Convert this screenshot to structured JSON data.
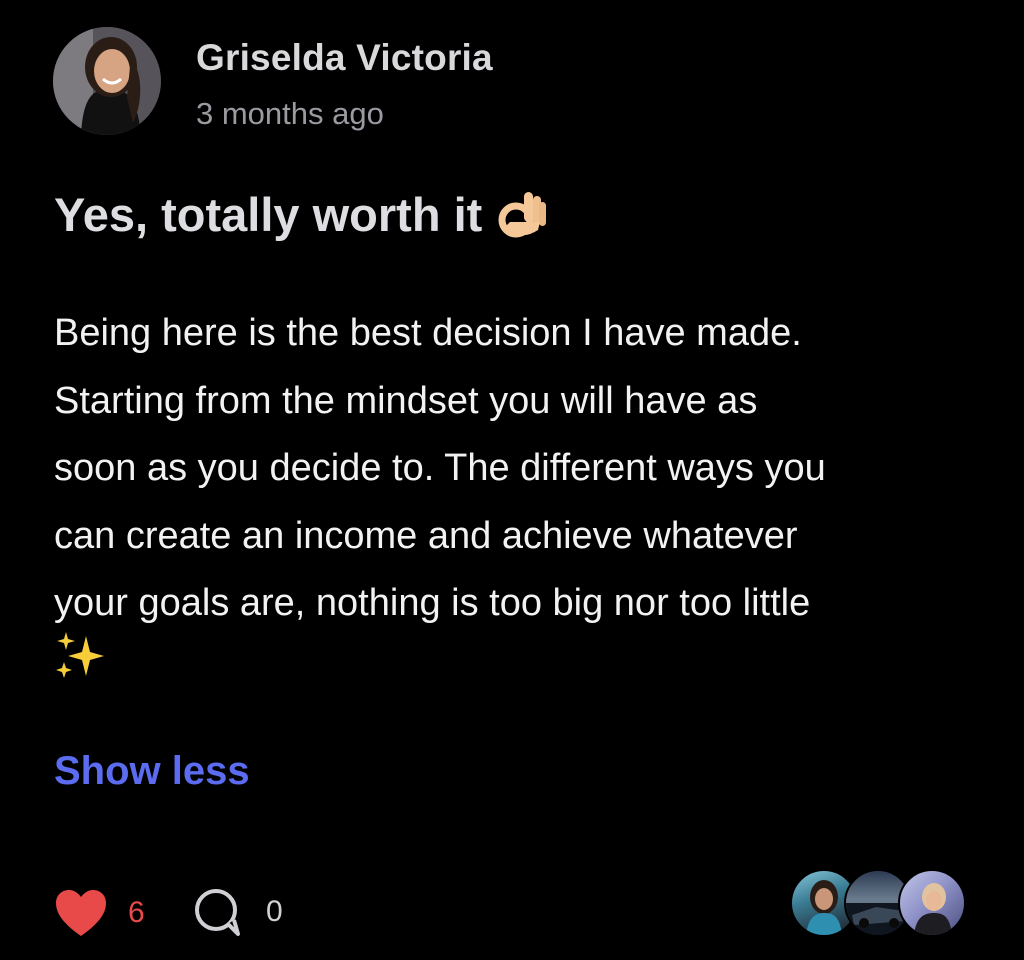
{
  "post": {
    "author": {
      "name": "Griselda Victoria",
      "timestamp": "3 months ago"
    },
    "title": "Yes, totally worth it",
    "title_emoji_icon": "ok-hand-icon",
    "body_lines": [
      "Being here is the best decision I have made.",
      "Starting from the mindset you will have as",
      "soon as you decide to. The different ways you",
      "can create an income and achieve whatever",
      "your goals are, nothing is too big nor too little"
    ],
    "body_emoji_icon": "sparkles-icon",
    "show_less_label": "Show less",
    "footer": {
      "like_count": "6",
      "comment_count": "0",
      "reactor_avatars": [
        "avatar",
        "avatar",
        "avatar"
      ]
    }
  },
  "colors": {
    "background": "#000000",
    "link": "#5b6cf0",
    "like": "#e84a4a",
    "secondary_text": "#9a9aa0"
  }
}
